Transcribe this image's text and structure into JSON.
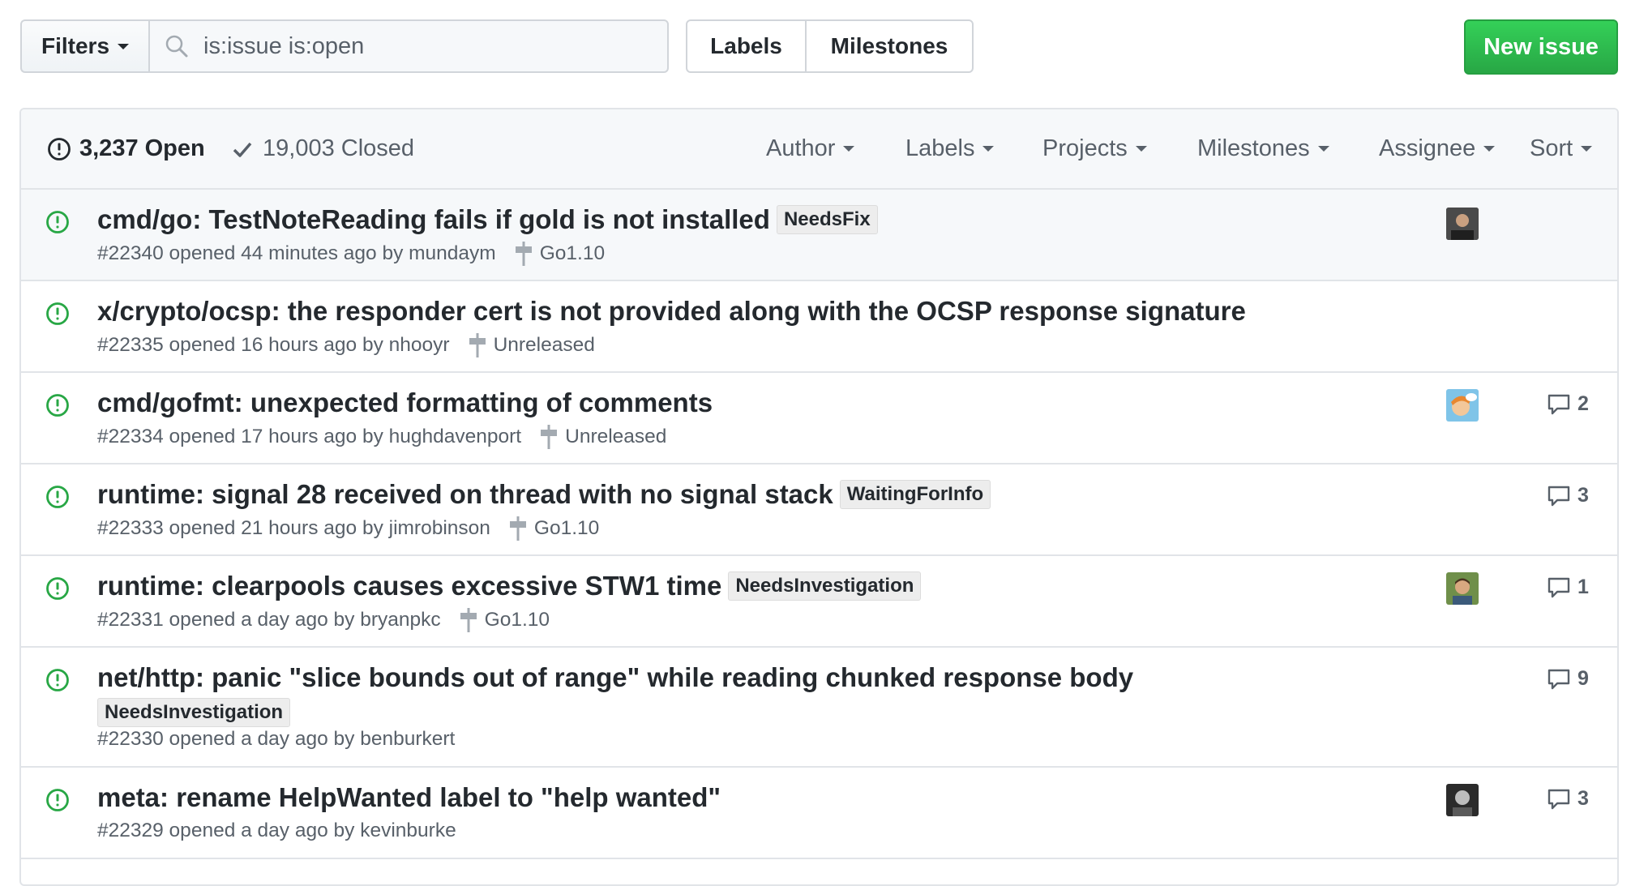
{
  "toolbar": {
    "filters_label": "Filters",
    "search_value": "is:issue is:open",
    "labels_label": "Labels",
    "milestones_label": "Milestones",
    "new_issue_label": "New issue"
  },
  "list_header": {
    "open_count": "3,237 Open",
    "closed_count": "19,003 Closed",
    "filters": [
      "Author",
      "Labels",
      "Projects",
      "Milestones",
      "Assignee",
      "Sort"
    ]
  },
  "issues": [
    {
      "title": "cmd/go: TestNoteReading fails if gold is not installed",
      "labels": [
        "NeedsFix"
      ],
      "meta": "#22340 opened 44 minutes ago by mundaym",
      "milestone": "Go1.10",
      "comments": "",
      "avatar": "dark"
    },
    {
      "title": "x/crypto/ocsp: the responder cert is not provided along with the OCSP response signature",
      "labels": [],
      "meta": "#22335 opened 16 hours ago by nhooyr",
      "milestone": "Unreleased",
      "comments": "",
      "avatar": ""
    },
    {
      "title": "cmd/gofmt: unexpected formatting of comments",
      "labels": [],
      "meta": "#22334 opened 17 hours ago by hughdavenport",
      "milestone": "Unreleased",
      "comments": "2",
      "avatar": "cartoon"
    },
    {
      "title": "runtime: signal 28 received on thread with no signal stack",
      "labels": [
        "WaitingForInfo"
      ],
      "meta": "#22333 opened 21 hours ago by jimrobinson",
      "milestone": "Go1.10",
      "comments": "3",
      "avatar": ""
    },
    {
      "title": "runtime: clearpools causes excessive STW1 time",
      "labels": [
        "NeedsInvestigation"
      ],
      "meta": "#22331 opened a day ago by bryanpkc",
      "milestone": "Go1.10",
      "comments": "1",
      "avatar": "outdoor"
    },
    {
      "title": "net/http: panic \"slice bounds out of range\" while reading chunked response body",
      "labels": [
        "NeedsInvestigation"
      ],
      "meta": "#22330 opened a day ago by benburkert",
      "milestone": "",
      "comments": "9",
      "avatar": ""
    },
    {
      "title": "meta: rename HelpWanted label to \"help wanted\"",
      "labels": [],
      "meta": "#22329 opened a day ago by kevinburke",
      "milestone": "",
      "comments": "3",
      "avatar": "grey"
    }
  ],
  "colors": {
    "open_icon": "#28a745",
    "primary_button": "#28a745",
    "label_bg": "#ededed",
    "muted_text": "#586069"
  },
  "icons": {
    "open_issue": "issue-opened-icon",
    "closed_check": "check-icon",
    "search": "search-icon",
    "milestone": "milestone-icon",
    "comment": "comment-icon"
  }
}
